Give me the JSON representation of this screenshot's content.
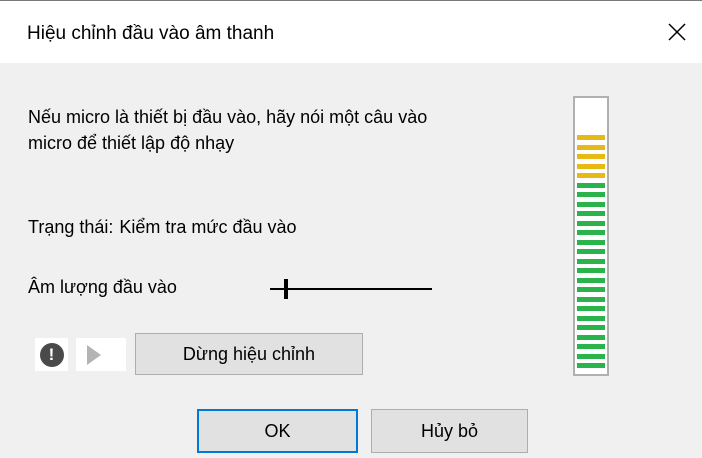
{
  "window": {
    "title": "Hiệu chỉnh đầu vào âm thanh",
    "close_glyph": "✕"
  },
  "main": {
    "description": "Nếu micro là thiết bị đầu vào, hãy nói một câu vào micro để thiết lập độ nhạy",
    "status_label": "Trạng thái:",
    "status_value": "Kiểm tra mức đầu vào",
    "volume_label": "Âm lượng đầu vào",
    "volume_level_percent": 9
  },
  "controls": {
    "warning_icon_glyph": "!",
    "stop_label": "Dừng hiệu chỉnh"
  },
  "footer": {
    "ok_label": "OK",
    "cancel_label": "Hủy bỏ"
  },
  "meter": {
    "total_segments": 28,
    "yellow_segments": 5,
    "green_segments": 20,
    "colors": {
      "green": "#29b34a",
      "yellow": "#e8b816",
      "empty": "#ffffff"
    }
  }
}
